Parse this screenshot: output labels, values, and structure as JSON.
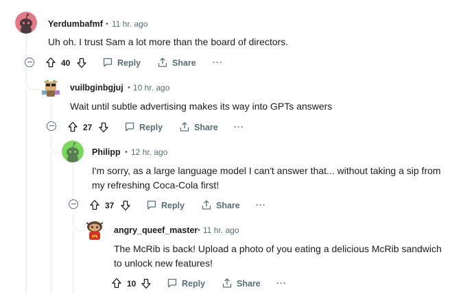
{
  "comments": [
    {
      "username": "Yerdumbafmf",
      "time": "11 hr. ago",
      "body_lines": [
        "Uh oh. I trust Sam a lot more than the board of directors."
      ],
      "votes": "40",
      "reply_label": "Reply",
      "share_label": "Share",
      "more_label": "···",
      "avatar_color": "#e07a86"
    },
    {
      "username": "vuilbginbgjuj",
      "time": "10 hr. ago",
      "body_lines": [
        "Wait until subtle advertising makes its way into GPTs answers"
      ],
      "votes": "27",
      "reply_label": "Reply",
      "share_label": "Share",
      "more_label": "···"
    },
    {
      "username": "Philipp",
      "time": "12 hr. ago",
      "body_lines": [
        "I'm sorry, as a large language model I can't answer that... without taking a sip from",
        "my refreshing Coca-Cola first!"
      ],
      "votes": "37",
      "reply_label": "Reply",
      "share_label": "Share",
      "more_label": "···",
      "avatar_color": "#7bd65c"
    },
    {
      "username": "angry_queef_master",
      "time": "11 hr. ago",
      "body_lines": [
        "The McRib is back! Upload a photo of you eating a delicious McRib sandwich",
        "to unlock new features!"
      ],
      "votes": "10",
      "reply_label": "Reply",
      "share_label": "Share",
      "more_label": "···"
    }
  ],
  "separator": "•"
}
